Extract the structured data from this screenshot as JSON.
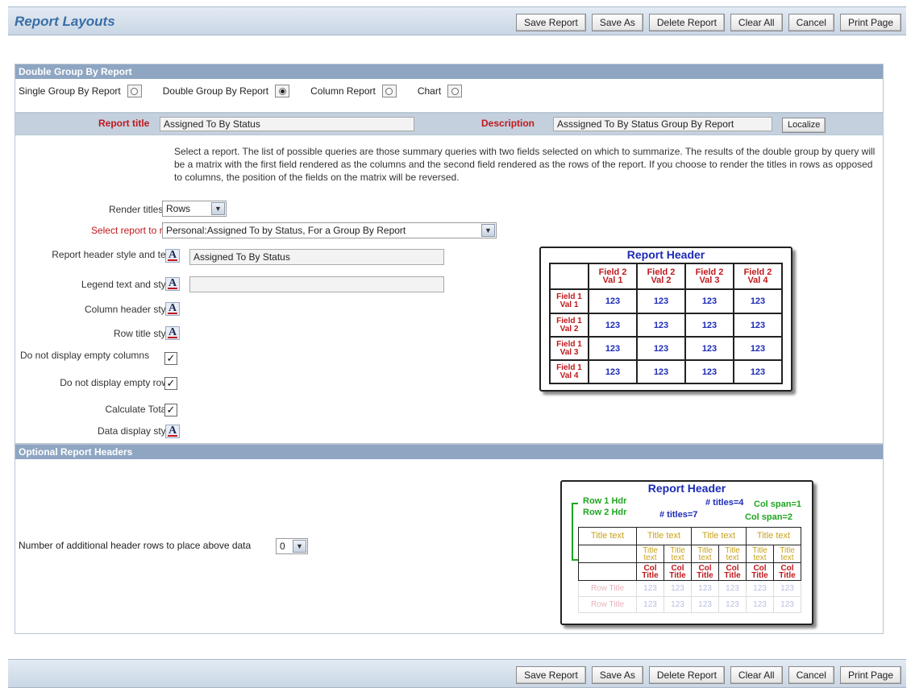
{
  "app_title": "Report Layouts",
  "toolbar": {
    "save_report": "Save Report",
    "save_as": "Save As",
    "delete_report": "Delete Report",
    "clear_all": "Clear All",
    "cancel": "Cancel",
    "print_page": "Print Page"
  },
  "report_type": {
    "header": "Double Group By Report",
    "options": [
      {
        "label": "Single Group By Report",
        "selected": false
      },
      {
        "label": "Double Group By Report",
        "selected": true
      },
      {
        "label": "Column Report",
        "selected": false
      },
      {
        "label": "Chart",
        "selected": false
      }
    ]
  },
  "title_bar": {
    "report_title_label": "Report title",
    "report_title_value": "Assigned To By Status",
    "description_label": "Description",
    "description_value": "Asssigned To By Status Group By Report",
    "localize": "Localize"
  },
  "main": {
    "description": "Select a report. The list of possible queries are those summary queries with two fields selected on which to summarize. The results of the double group by query will be a matrix with the first field rendered as the columns and the second field rendered as the rows of the report. If you choose to render the titles in rows as opposed to columns, the position of the fields on the matrix will be reversed.",
    "render_titles_label": "Render titles in",
    "render_titles_value": "Rows",
    "select_report_label": "Select report to run",
    "select_report_value": "Personal:Assigned To by Status, For a Group By Report",
    "header_style_label": "Report header style and text",
    "header_text_value": "Assigned To By Status",
    "legend_label": "Legend text and style",
    "legend_value": "",
    "column_header_label": "Column header style",
    "row_title_label": "Row title style",
    "no_empty_columns_label": "Do not display empty columns",
    "no_empty_rows_label": "Do not display empty rows",
    "calculate_totals_label": "Calculate Totals",
    "data_display_label": "Data display style",
    "style_icon_glyph": "A"
  },
  "preview1": {
    "title": "Report Header",
    "col_headers": [
      "Field 2\nVal 1",
      "Field 2\nVal 2",
      "Field 2\nVal 3",
      "Field 2\nVal 4"
    ],
    "row_headers": [
      "Field 1\nVal 1",
      "Field 1\nVal 2",
      "Field 1\nVal 3",
      "Field 1\nVal 4"
    ],
    "cell_value": "123"
  },
  "optional": {
    "header": "Optional Report Headers",
    "rows_label": "Number of additional header rows to place above data",
    "rows_value": "0"
  },
  "preview2": {
    "title": "Report Header",
    "row1": "Row 1 Hdr",
    "row2": "Row 2 Hdr",
    "titles4": "# titles=4",
    "titles7": "# titles=7",
    "colspan1": "Col span=1",
    "colspan2": "Col span=2",
    "title_text": "Title text",
    "title_small": "Title text",
    "col_title": "Col Title",
    "row_title": "Row Title",
    "cell": "123"
  }
}
